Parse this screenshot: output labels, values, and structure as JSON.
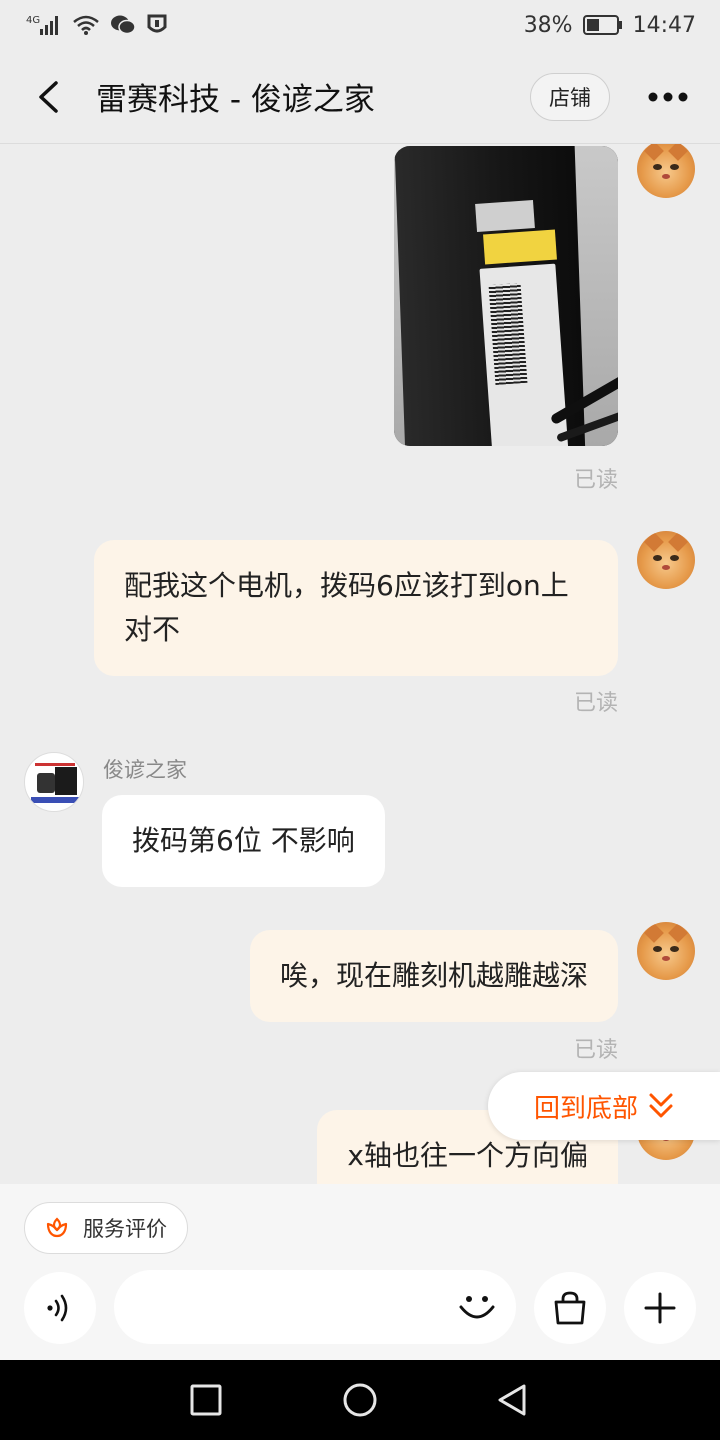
{
  "status_bar": {
    "network": "4G",
    "battery_percent": "38%",
    "time": "14:47",
    "icons": [
      "signal-icon",
      "wifi-icon",
      "wechat-icon",
      "shield-icon",
      "battery-icon"
    ]
  },
  "header": {
    "title": "雷赛科技 - 俊谚之家",
    "shop_button": "店铺",
    "icons": [
      "back-arrow-icon",
      "more-icon"
    ]
  },
  "messages": [
    {
      "side": "me",
      "type": "image",
      "status": "已读"
    },
    {
      "side": "me",
      "type": "text",
      "text": "配我这个电机，拨码6应该打到on上对不",
      "status": "已读"
    },
    {
      "side": "them",
      "sender": "俊谚之家",
      "type": "text",
      "text": "拨码第6位  不影响"
    },
    {
      "side": "me",
      "type": "text",
      "text": "唉，现在雕刻机越雕越深",
      "status": "已读"
    },
    {
      "side": "me",
      "type": "text",
      "text": "x轴也往一个方向偏"
    }
  ],
  "back_to_bottom": "回到底部",
  "bottom_bar": {
    "service_rating": "服务评价",
    "input_placeholder": "",
    "icons": [
      "voice-icon",
      "emoji-icon",
      "shopping-bag-icon",
      "plus-icon"
    ]
  },
  "nav_bar": {
    "icons": [
      "recent-apps-icon",
      "home-icon",
      "back-triangle-icon"
    ]
  },
  "colors": {
    "accent": "#ff5500",
    "my_bubble": "#fdf4e8",
    "their_bubble": "#ffffff",
    "background": "#ededed"
  }
}
